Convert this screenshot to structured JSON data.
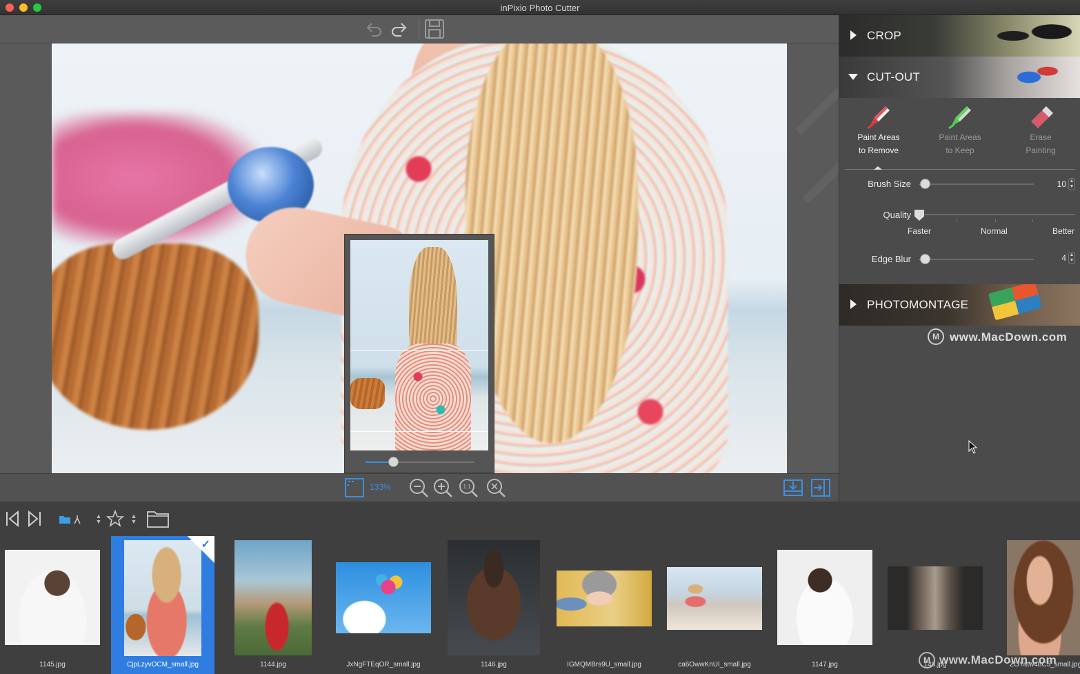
{
  "window": {
    "title": "inPixio Photo Cutter"
  },
  "toolbar": {
    "undo": "undo-icon",
    "redo": "redo-icon",
    "save": "save-icon"
  },
  "canvas": {
    "zoom_label": "133%",
    "navigator_zoom": 0.25
  },
  "panel": {
    "crop": {
      "title": "CROP",
      "expanded": false
    },
    "cutout": {
      "title": "CUT-OUT",
      "expanded": true,
      "tools": [
        {
          "line1": "Paint Areas",
          "line2": "to Remove",
          "active": true,
          "color": "#e0393e"
        },
        {
          "line1": "Paint Areas",
          "line2": "to Keep",
          "active": false,
          "color": "#4ccf4c"
        },
        {
          "line1": "Erase",
          "line2": "Painting",
          "active": false,
          "color": "#d65a6c"
        }
      ],
      "brush_size": {
        "label": "Brush Size",
        "value": "10",
        "level": 0.05
      },
      "quality": {
        "label": "Quality",
        "options": [
          "Faster",
          "Normal",
          "Better"
        ],
        "selected": "Faster"
      },
      "edge_blur": {
        "label": "Edge Blur",
        "value": "4",
        "level": 0.05
      }
    },
    "photomontage": {
      "title": "PHOTOMONTAGE",
      "expanded": false
    }
  },
  "watermarks": {
    "panel": "www.MacDown.com",
    "film": "www.MacDown.com"
  },
  "filmstrip": [
    {
      "name": "1145.jpg",
      "selected": false
    },
    {
      "name": "CjpLzyvOCM_small.jpg",
      "selected": true
    },
    {
      "name": "1144.jpg",
      "selected": false
    },
    {
      "name": "JxNgFTEqOR_small.jpg",
      "selected": false
    },
    {
      "name": "1146.jpg",
      "selected": false
    },
    {
      "name": "IGMQMBrs9U_small.jpg",
      "selected": false
    },
    {
      "name": "ca6OwwKnUI_small.jpg",
      "selected": false
    },
    {
      "name": "1147.jpg",
      "selected": false
    },
    {
      "name": "148.jpg",
      "selected": false
    },
    {
      "name": "ZOYatw48C5_small.jpg",
      "selected": false
    }
  ],
  "colors": {
    "accent": "#2f7de1",
    "panel_bg": "#4b4b4b"
  }
}
